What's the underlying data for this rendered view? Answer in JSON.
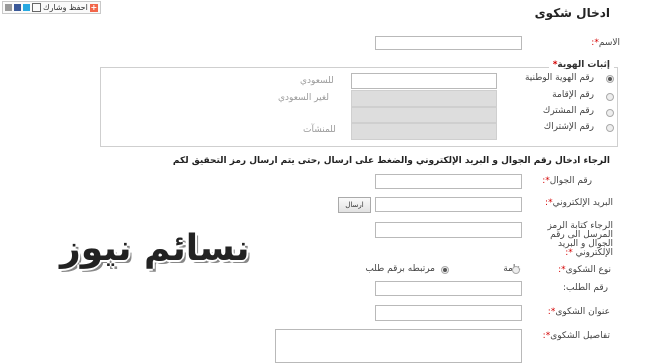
{
  "share": {
    "label": "احفظ وشارك"
  },
  "page_title": "ادخال شكوى",
  "name": {
    "label": "الاسم",
    "star": "*:"
  },
  "identity": {
    "legend": "إثبات الهوية",
    "legend_star": "*",
    "options": [
      {
        "label": "رقم الهوية الوطنية",
        "hint": "للسعودي",
        "selected": true
      },
      {
        "label": "رقم الإقامة",
        "hint": "لغير السعودي",
        "selected": false
      },
      {
        "label": "رقم المشترك",
        "hint": "",
        "selected": false
      },
      {
        "label": "رقم الإشتراك",
        "hint": "للمنشآت",
        "selected": false
      }
    ]
  },
  "notice": "الرجاء ادخال رقم الجوال و البريد الإلكتروني والضغط على ارسال ,حتى يتم ارسال رمز التحقيق لكم",
  "mobile": {
    "label": "رقم الجوال",
    "star": "*:"
  },
  "email": {
    "label": "البريد الإلكتروني",
    "star": "*:",
    "send_button": "ارسال"
  },
  "code": {
    "line1": "الرجاء كتابة الرمز",
    "line2": "المرسل الى رقم",
    "line3": "الجوال و البريد",
    "line4": "الإلكتروني",
    "star": "*:"
  },
  "complaint_type": {
    "label": "نوع الشكوى",
    "star": "*:",
    "option_general": "عامة",
    "option_linked": "مرتبطه برقم طلب"
  },
  "request_number": {
    "label": "رقم الطلب:"
  },
  "complaint_title": {
    "label": "عنوان الشكوى",
    "star": "*:"
  },
  "complaint_details": {
    "label": "تفاصيل الشكوى",
    "star": "*:"
  },
  "watermark": "نسائم نيوز"
}
